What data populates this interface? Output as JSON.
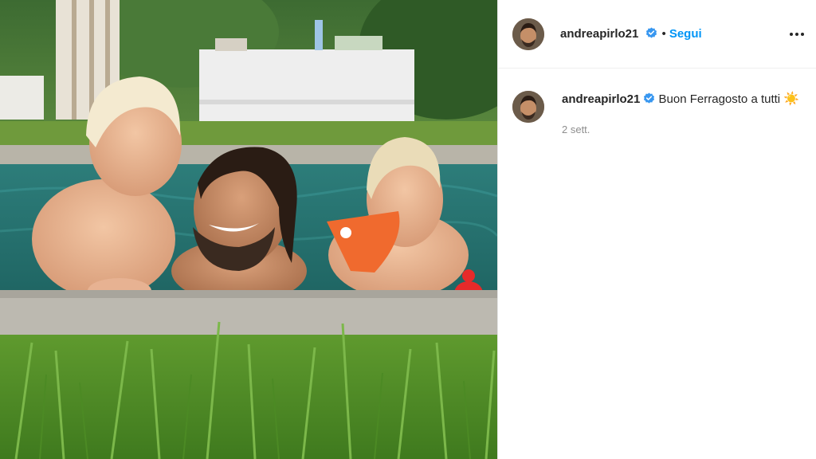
{
  "post": {
    "photo_alt": "",
    "username": "andreapirlo21",
    "verified": true,
    "follow_label": "Segui",
    "separator": "•"
  },
  "caption": {
    "username": "andreapirlo21",
    "text": "Buon Ferragosto a tutti",
    "emoji": "☀️",
    "timestamp": "2 sett."
  },
  "colors": {
    "accent": "#0095f6",
    "verified_badge": "#3897f0",
    "text": "#262626",
    "muted": "#8e8e8e"
  },
  "icons": {
    "verified": "verified-badge-icon",
    "more": "more-options-icon"
  }
}
